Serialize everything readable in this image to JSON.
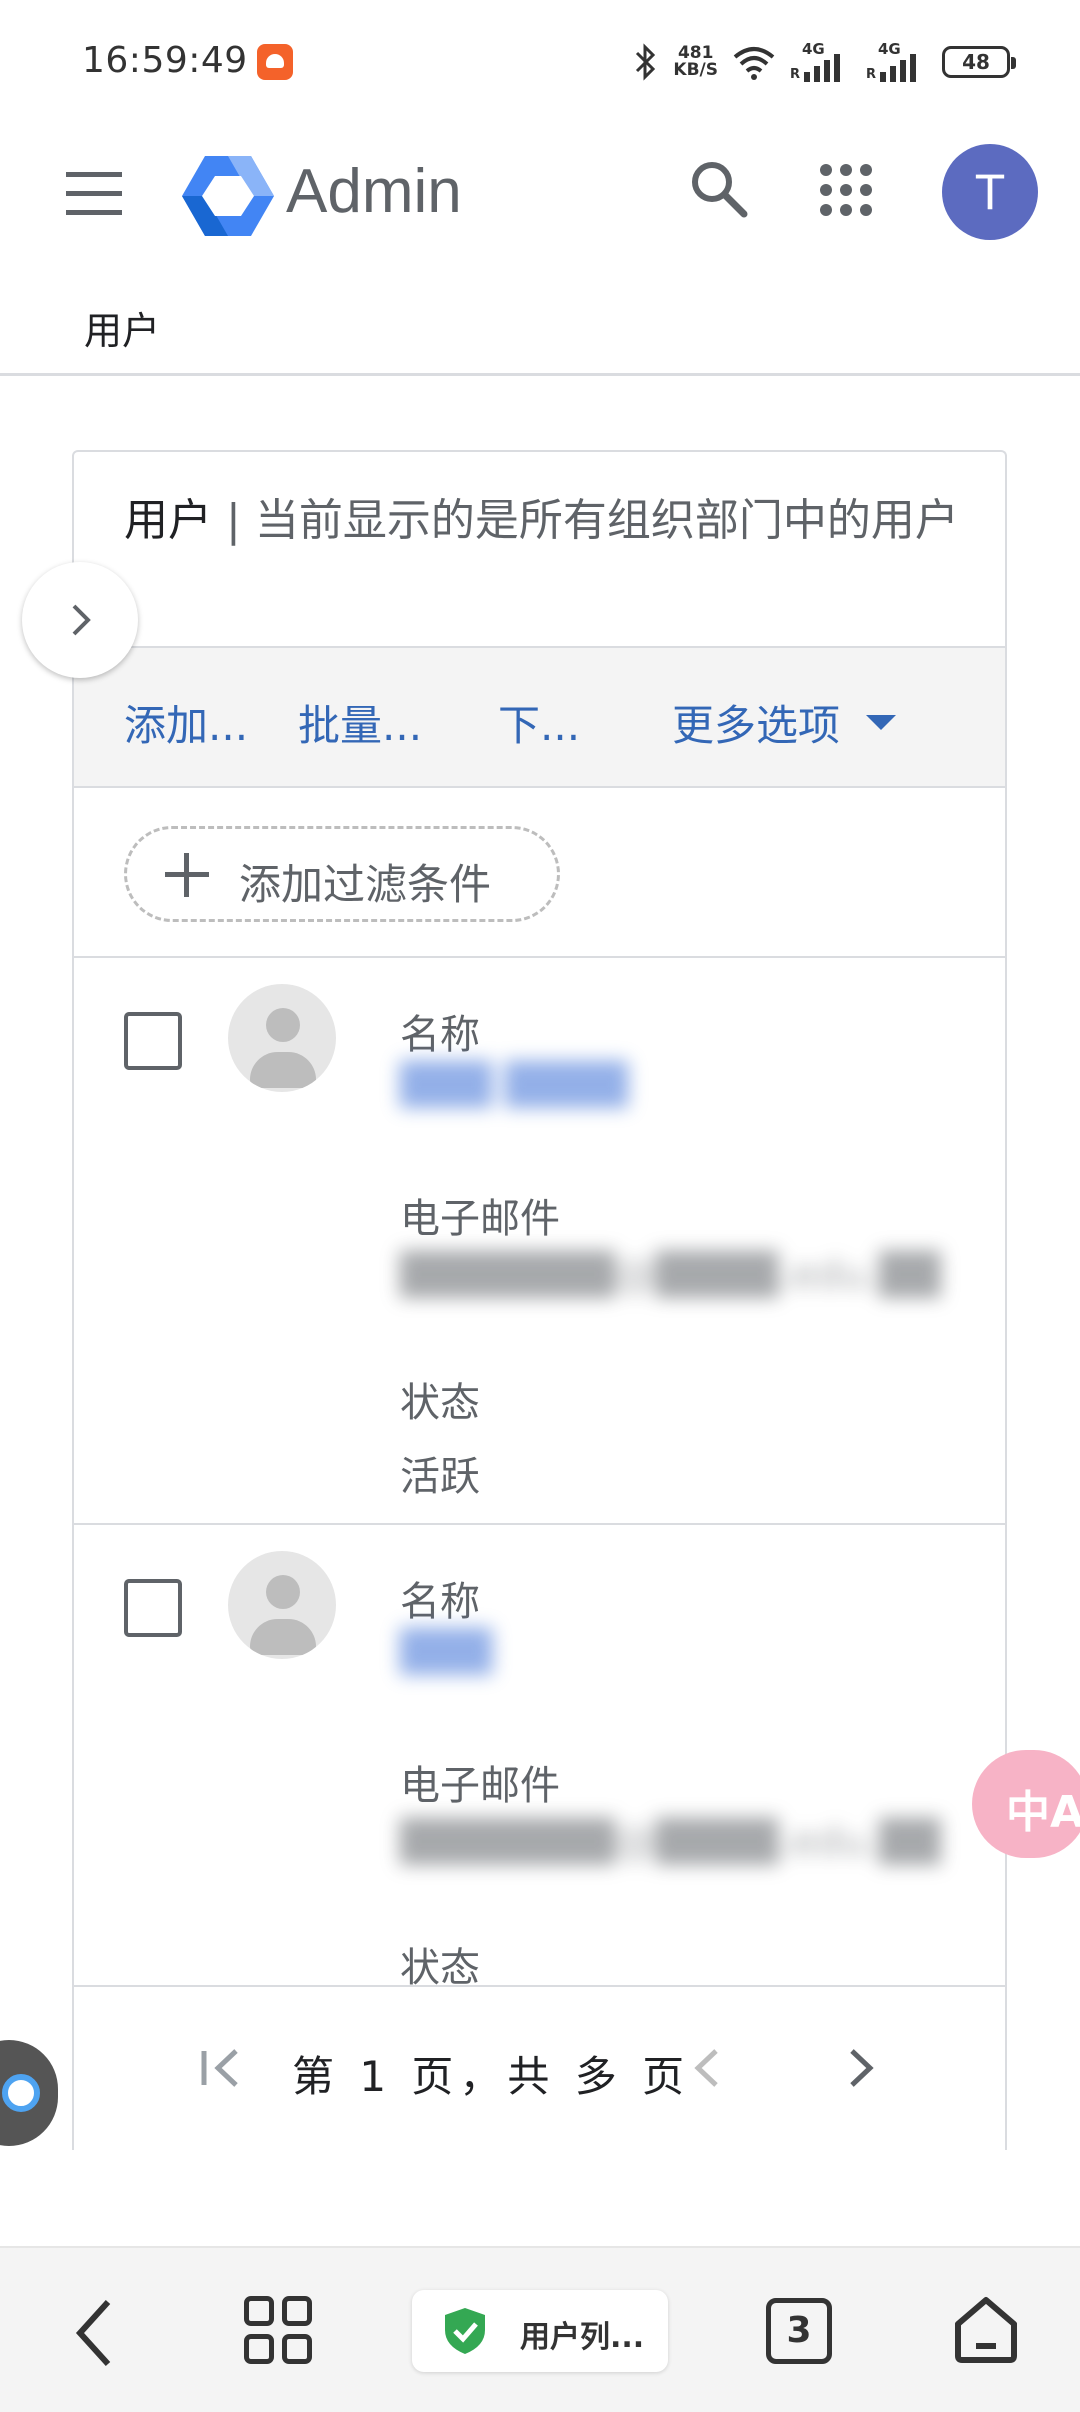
{
  "status_bar": {
    "time": "16:59:49",
    "net_speed_value": "481",
    "net_speed_unit": "KB/S",
    "signal1_label": "4G",
    "signal2_label": "4G",
    "roaming": "R",
    "battery": "48"
  },
  "header": {
    "app_title": "Admin",
    "avatar_initial": "T"
  },
  "breadcrumb": {
    "label": "用户"
  },
  "card": {
    "title_strong": "用户",
    "title_sep": "|",
    "title_rest": "当前显示的是所有组织部门中的用户"
  },
  "actions": {
    "add_user": "添加...",
    "bulk_update": "批量...",
    "download": "下...",
    "more_options": "更多选项"
  },
  "filter": {
    "add_filter_label": "添加过滤条件"
  },
  "users": [
    {
      "name_label": "名称",
      "name_value": "███ ████",
      "email_label": "电子邮件",
      "email_value": "███████@████.edu.██",
      "status_label": "状态",
      "status_value": "活跃"
    },
    {
      "name_label": "名称",
      "name_value": "███",
      "email_label": "电子邮件",
      "email_value": "███████@████.edu.██",
      "status_label": "状态"
    }
  ],
  "pager": {
    "text": "第 1 页，共 多 页"
  },
  "bottom_nav": {
    "tab_label": "用户列...",
    "tab_count": "3"
  },
  "floating": {
    "translate_glyph": "中A"
  },
  "colors": {
    "link_blue": "#3367b6",
    "avatar_bg": "#5c6bc0",
    "logo_blue": "#4285f4",
    "shield_green": "#34a853"
  }
}
